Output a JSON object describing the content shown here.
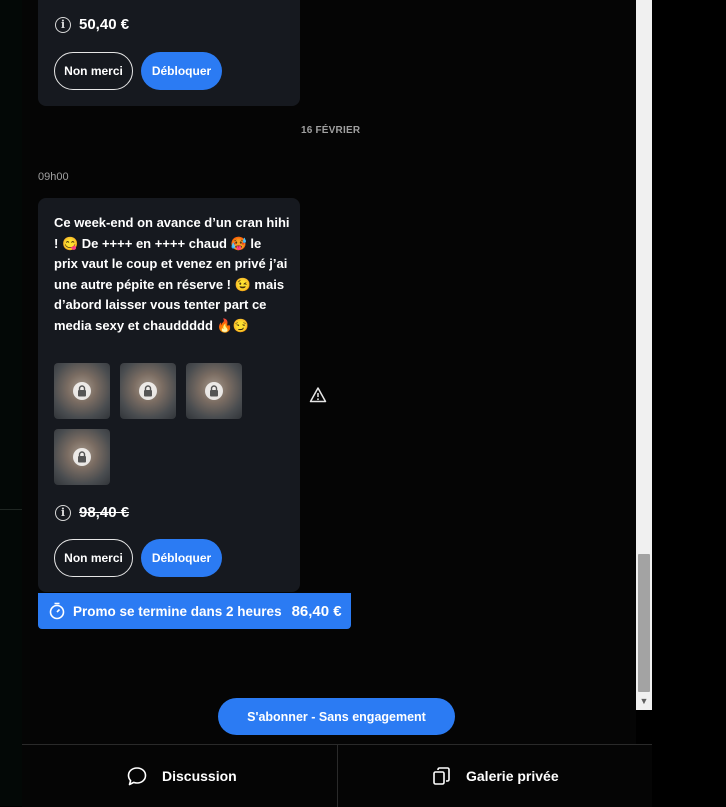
{
  "card1": {
    "price": "50,40 €",
    "no_thanks": "Non merci",
    "unlock": "Débloquer"
  },
  "date_separator": "16 FÉVRIER",
  "message": {
    "time": "09h00",
    "text_lines": [
      "Ce week-end on avance d’un cran hihi",
      "! 😋 De ++++ en ++++ chaud 🥵 le",
      "prix vaut le coup et venez en privé j’ai",
      "une autre pépite en réserve ! 😉 mais",
      "d’abord laisser vous tenter part ce",
      "media sexy et chauddddd 🔥😏"
    ],
    "locked_media_count": 4,
    "original_price": "98,40 €",
    "no_thanks": "Non merci",
    "unlock": "Débloquer"
  },
  "promo": {
    "text": "Promo se termine dans 2 heures",
    "price": "86,40 €"
  },
  "subscribe_label": "S'abonner - Sans engagement",
  "nav": {
    "discussion": "Discussion",
    "gallery": "Galerie privée"
  },
  "icons": [
    "info-icon",
    "lock-icon",
    "warning-icon",
    "timer-icon",
    "chat-bubble-icon",
    "gallery-icon"
  ],
  "colors": {
    "accent": "#2b7bf3",
    "card": "#16191f",
    "background": "#050505"
  }
}
